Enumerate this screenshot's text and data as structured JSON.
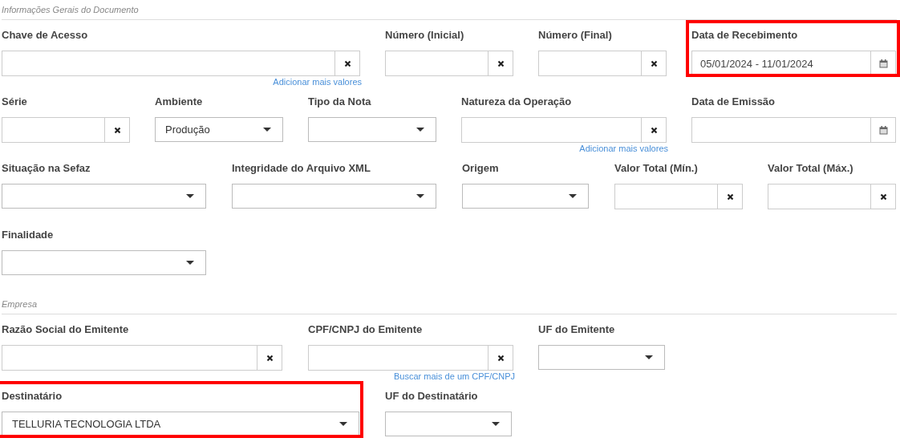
{
  "sections": [
    {
      "title": "Informações Gerais do Documento",
      "rows": [
        [
          {
            "label": "Chave de Acesso",
            "kind": "clear",
            "link": "Adicionar mais valores"
          },
          {
            "label": "Número (Inicial)",
            "kind": "clear"
          },
          {
            "label": "Número (Final)",
            "kind": "clear"
          },
          {
            "label": "Data de Recebimento",
            "kind": "date",
            "value": "05/01/2024 - 11/01/2024",
            "highlighted": true
          }
        ],
        [
          {
            "label": "Série",
            "kind": "clear"
          },
          {
            "label": "Ambiente",
            "kind": "select",
            "value": "Produção"
          },
          {
            "label": "Tipo da Nota",
            "kind": "select"
          },
          {
            "label": "Natureza da Operação",
            "kind": "clear",
            "link": "Adicionar mais valores"
          },
          {
            "label": "Data de Emissão",
            "kind": "date"
          }
        ],
        [
          {
            "label": "Situação na Sefaz",
            "kind": "select"
          },
          {
            "label": "Integridade do Arquivo XML",
            "kind": "select"
          },
          {
            "label": "Origem",
            "kind": "select"
          },
          {
            "label": "Valor Total (Mín.)",
            "kind": "clear"
          },
          {
            "label": "Valor Total (Máx.)",
            "kind": "clear"
          }
        ],
        [
          {
            "label": "Finalidade",
            "kind": "select"
          }
        ]
      ]
    },
    {
      "title": "Empresa",
      "rows": [
        [
          {
            "label": "Razão Social do Emitente",
            "kind": "clear"
          },
          {
            "label": "CPF/CNPJ do Emitente",
            "kind": "clear",
            "link": "Buscar mais de um CPF/CNPJ"
          },
          {
            "label": "UF do Emitente",
            "kind": "select"
          }
        ],
        [
          {
            "label": "Destinatário",
            "kind": "select",
            "value": "TELLURIA TECNOLOGIA LTDA",
            "highlighted": true
          },
          {
            "label": "UF do Destinatário",
            "kind": "select"
          }
        ]
      ]
    }
  ]
}
